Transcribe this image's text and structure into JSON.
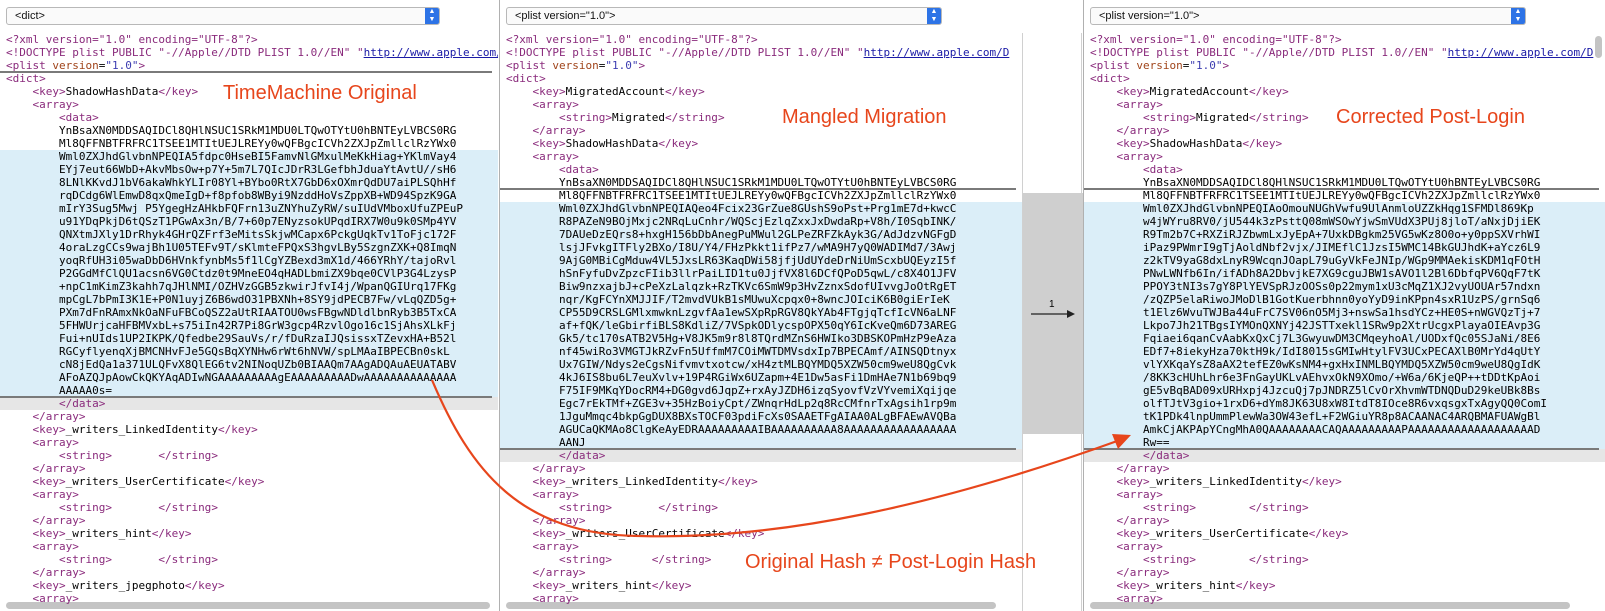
{
  "left_pane": {
    "selector": "<dict>",
    "lines": [
      "<?xml version=\"1.0\" encoding=\"UTF-8\"?>",
      "<!DOCTYPE plist PUBLIC \"-//Apple//DTD PLIST 1.0//EN\" \"http://www.apple.com/D",
      "<plist version=\"1.0\">",
      "<dict>",
      "    <key>ShadowHashData</key>",
      "    <array>",
      "        <data>",
      "        YnBsaXN0MDDSAQIDCl8QHlNSUC1SRkM1MDU0LTQwOTYtU0hBNTEyLVBCS0RG",
      "        Ml8QFFNBTFRFRC1TSEE1MTItUEJLREYy0wQFBgcICVh2ZXJpZmllclRzYWx0",
      "        Wml0ZXJhdGlvbnNPEQIA5fdpc0HseBI5FamvNlGMxulMeKkHiag+YKlmVay4",
      "        EYj7eut66WbD+AkvMbsOw+p7Y+5m7L7QIcJDrR3LGefbhJduaYtAvtU//sH6",
      "        8LNlKKvdJ1bV6akaWhkYLIr08Yl+BYbo0RtX7GbD6xOXmrQdDU7aiPLSQhHf",
      "        rqDCdg6WlEmwD8qxQmeIgD+f8pfob8WByi9NzddHoVsZppXB+WD94SpzK9GA",
      "        mIrY3Sug5Mwj P5YgegHzAHkbFQFrn13uZNYhuZyRW/suIUdVMboxUfuZPEuP",
      "        u91YDqPkjD6tQSzT1PGwAx3n/B/7+60p7ENyzsokUPqdIRX7W0u9k0SMp4YV",
      "        QNXtmJXly1DrRhyk4GHrQZFrf3eMitsSkjwMCapx6PckgUqkTv1ToFjc172F",
      "        4oraLzgCCs9wajBh1U05TEFv9T/sKlmteFPQxS3hgvLBy5SzgnZXK+Q8ImqN",
      "        yoqRfUH3i05waDbD6HVnkfynbMs5f1lCgYZBexd3mX1d/466YRhY/tajoRvl",
      "        P2GGdMfClQU1acsn6VG0Ctdz0t9MneEO4qHADLbmiZX9bqe0CVlP3G4LzysP",
      "        +npC1mKimZ3kahh7qJHlNMI/OZHVzGGB5zkwirJfvI4j/WpanQGIUrq17FKg",
      "        mpCgL7bPmI3K1E+P0N1uyjZ6B6wdO31PBXNh+8SY9jdPECB7Fw/vLqQZD5g+",
      "        PXm7dFnRAmxNkOaNFuFBCoQSZ2aUtRIAATOU0wsFBgwNDldlbnRyb3B5TxCA",
      "        5FHWUrjcaHFBMVxbL+s75iIn42R7Pi8GrW3gcp4RzvlOgo16c1SjAhsXLkFj",
      "        Fui+nUIds1UP2IKPK/Qfedbe29SauVs/r/fDuRzaIJQsissxTZevxHA+B52l",
      "        RGCyflyenqXjBMCNHvFJe5GQsBqXYNHw6rWt6hNVW/spLMAaIBPECBn0skL",
      "        cN8jEdQa1a371ULQFvX8QlEG6tv2NINoqUZb0BIAAQm7AAgADQAuAEUATABV",
      "        AFoAZQJpAowCkQKYAqADIwNGAAAAAAAAAgEAAAAAAAAADwAAAAAAAAAAAAAA",
      "        AAAAA0s=",
      "        </data>",
      "    </array>",
      "    <key>_writers_LinkedIdentity</key>",
      "    <array>",
      "        <string>       </string>",
      "    </array>",
      "    <key>_writers_UserCertificate</key>",
      "    <array>",
      "        <string>       </string>",
      "    </array>",
      "    <key>_writers_hint</key>",
      "    <array>",
      "        <string>       </string>",
      "    </array>",
      "    <key>_writers_jpegphoto</key>",
      "    <array>"
    ]
  },
  "middle_pane": {
    "selector": "<plist version=\"1.0\">",
    "lines": [
      "<?xml version=\"1.0\" encoding=\"UTF-8\"?>",
      "<!DOCTYPE plist PUBLIC \"-//Apple//DTD PLIST 1.0//EN\" \"http://www.apple.com/D",
      "<plist version=\"1.0\">",
      "<dict>",
      "    <key>MigratedAccount</key>",
      "    <array>",
      "        <string>Migrated</string>",
      "    </array>",
      "    <key>ShadowHashData</key>",
      "    <array>",
      "        <data>",
      "        YnBsaXN0MDDSAQIDCl8QHlNSUC1SRkM1MDU0LTQwOTYtU0hBNTEyLVBCS0RG",
      "        Ml8QFFNBTFRFRC1TSEE1MTItUEJLREYy0wQFBgcICVh2ZXJpZmllclRzYWx0",
      "        Wml0ZXJhdGlvbnNPEQIAQeo4Fcix23GrZue8GUshS9oPst+Prg1mE7d+kwcC",
      "        R8PAZeN9BOjMxjc2NRqLuCnhr/WQScjEzlqZxxJxDwdaRp+V8h/I0SqbINK/",
      "        7DAUeDzEQrs8+hxgH156bDbAnegPuMWul2GLPeZRFZkAyk3G/AdJdzvNGFgD",
      "        lsjJFvkgITFly2BXo/I8U/Y4/FHzPkkt1ifPz7/wMA9H7yQ0WADIMd7/3Awj",
      "        9AjG0MBiCgMduw4VL5JxsLR63KaqDWi58jfjUdUYdeDrNiUmScxbUQEyzI5f",
      "        hSnFyfuDvZpzcFIib3llrPaiLID1tu0JjfVX8l6DCfQPoD5qwL/c8X4O1JFV",
      "        Biw9nzxajbJ+cPeXzLalqzk+RzTKVc6SmW9p3HvZznxSdofUIvvgJoOtRgET",
      "        nqr/KgFCYnXMJJIF/T2mvdVUkB1sMUwuXcpqx0+8wncJOIciK6B0giErIeK",
      "        CP55D9CRSLGMlxmwknLzgvfAa1ewSXpRpRGV8QkYAb4FTgjqTcfIcVN6aLNF",
      "        af+fQK/leGbirfiBLS8KdliZ/7VSpkODlycspOPX50qY6IcKveQm6D73AREG",
      "        Gk5/tc170sATB2V5Hg+V8JK5m9r8l8TQrdMZnS6HWIko3DBSKOPmHzP9eAza",
      "        nf45wiRo3VMGTJkRZvFn5UffmM7COiMWTDMVsdxIp7BPECAmf/AINSQDtnyx",
      "        Ux7GIW/Ndys2eCgsNifvmvtxotcw/xH4ztMLBQYMDQ5XZW50cm9weU8QgCvk",
      "        4kJ6IS8bu6L7euXvlv+19P4RGiWx6UZapm+4E1Dw5asFi1DmHAe7N1b69bq9",
      "        F75IF9MKqYDocRM4+DG0gvd6JqpZ+rxAyJZDH6izqSyovfVzVYvemiXqijqe",
      "        Egc7rEkTMf+ZGE3v+35HzBoiyCpt/ZWnqrHdLp2q8RcCMfnrTxAgsih1rp9m",
      "        1JguMmqc4bkpGgDUX8BXsTOCF03pdiFcXs0SAAETFgAIAA0ALgBFAEwAVQBa",
      "        AGUCaQKMAo8ClgKeAyEDRAAAAAAAAAIBAAAAAAAAAA8AAAAAAAAAAAAAAAAA",
      "        AANJ",
      "        </data>",
      "    </array>",
      "    <key>_writers_LinkedIdentity</key>",
      "    <array>",
      "        <string>       </string>",
      "    </array>",
      "    <key>_writers_UserCertificate</key>",
      "    <array>",
      "        <string>      </string>",
      "    </array>",
      "    <key>_writers_hint</key>",
      "    <array>"
    ]
  },
  "right_pane": {
    "selector": "<plist version=\"1.0\">",
    "lines": [
      "<?xml version=\"1.0\" encoding=\"UTF-8\"?>",
      "<!DOCTYPE plist PUBLIC \"-//Apple//DTD PLIST 1.0//EN\" \"http://www.apple.com/D",
      "<plist version=\"1.0\">",
      "<dict>",
      "    <key>MigratedAccount</key>",
      "    <array>",
      "        <string>Migrated</string>",
      "    </array>",
      "    <key>ShadowHashData</key>",
      "    <array>",
      "        <data>",
      "        YnBsaXN0MDDSAQIDCl8QHlNSUC1SRkM1MDU0LTQwOTYtU0hBNTEyLVBCS0RG",
      "        Ml8QFFNBTFRFRC1TSEE1MTItUEJLREYy0wQFBgcICVh2ZXJpZmllclRzYWx0",
      "        Wml0ZXJhdGlvbnNPEQIAoOmouNUGhVwfu9UlAnmloUZZkHqg1SFMDl869Kp",
      "        w4jWYru8RV0/jU544k3zPsttQ08mWSOwYjwSmVUdX3PUj8jloT/aNxjDjiEK",
      "        R9Tm2b7C+RXZiRJZbwmLxJyEpA+7UxkDBgkm25VG5wKz8O0o+y0ppSXVrhWI",
      "        iPaz9PWmrI9gTjAoldNbf2vjx/JIMEflC1JzsI5WMC14BkGUJhdK+aYcz6L9",
      "        z2kTV9yaG8dxLnyR9WcqnJOapL79uGyVkFeJNIp/WGp9MMAekisKDM1qFOtH",
      "        PNwLWNfb6In/ifADh8A2DbvjkE7XG9cguJBW1sAVO1l2Bl6DbfqPV6QqF7tK",
      "        PPOY3tNI3s7gY8PlYEVSpRJzOOSs0p22mym1xU3cMqZ1XJ2vyUOUAr57ndxn",
      "        /zQZP5elaRiwoJMoDlB1GotKuerbhnn0yoYyD9inKPpn4sxR1UzPS/grnSq6",
      "        t1Elz6WvuTWJBa44uFrC7SV06nO5Mj3+nswSa1hsdYCz+HE0S+nWGVQzTj+7",
      "        Lkpo7Jh21TBgsIYMOnQXNYj42JSTTxekl1SRw9p2XtrUcgxPlayaOIEAvp3G",
      "        Fqiaei6qanCvAabKxQxCj7L3GwyuwDM3CMqeyhoAl/UODxfQc05SJaNi/8E6",
      "        EDf7+8iekyHza70ktH9k/IdI8015sGMIwHtylFV3UCxPECAXlB0MrYd4qUtY",
      "        vlYXKqaYsZ8aAX2tefEZ0wKsNM4+gxHxINMLBQYMDQ5XZW50cm9weU8QgIdK",
      "        /8KK3cHUhLhr6e3FnGayUKLvAEhvxOkN9XOmo/+W6a/6KjeQP++tDDtKpAoi",
      "        gE5vBqBAD09xURHxpj4JzcuQj7pJNDRZ5lCvOrXhvmWTDNQDuD29keUBk8Bs",
      "        olfTJtV3gio+1rxD6+dYm8JK63U8xW8ItdT8IOce8R6vxqsgxTxAgyQQ0ComI",
      "        tK1PDk4lnpUmmPlewWa3OW43efL+F2WGiuYR8p8ACAANAC4ARQBMAFUAWgBl",
      "        AmkCjAKPApYCngMhA0QAAAAAAAACAQAAAAAAAAAPAAAAAAAAAAAAAAAAAAAD",
      "        Rw==",
      "        </data>",
      "    </array>",
      "    <key>_writers_LinkedIdentity</key>",
      "    <array>",
      "        <string>        </string>",
      "    </array>",
      "    <key>_writers_UserCertificate</key>",
      "    <array>",
      "        <string>        </string>",
      "    </array>",
      "    <key>_writers_hint</key>",
      "    <array>"
    ]
  },
  "annotations": {
    "left_label": "TimeMachine Original",
    "middle_label": "Mangled Migration",
    "right_label": "Corrected Post-Login",
    "arrow_label": "Original Hash ≠ Post-Login Hash",
    "diff_marker": "1"
  },
  "colors": {
    "annotation": "#e7461c",
    "highlight": "#dbeef8",
    "accent": "#2d73e6"
  }
}
